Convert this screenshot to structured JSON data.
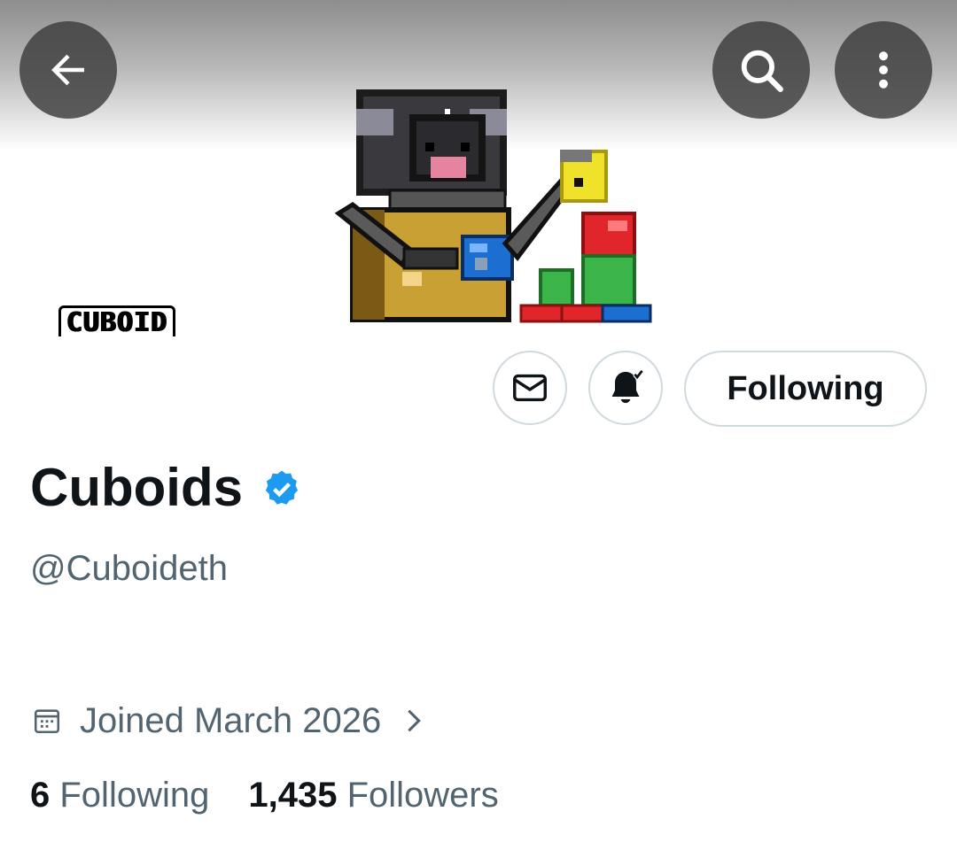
{
  "header": {
    "back_icon": "arrow-left-icon",
    "search_icon": "search-icon",
    "more_icon": "more-vertical-icon"
  },
  "banner": {
    "logo_text": "CUBOID"
  },
  "actions": {
    "message_icon": "mail-icon",
    "notifications_icon": "bell-check-icon",
    "follow_label": "Following"
  },
  "profile": {
    "display_name": "Cuboids",
    "handle": "@Cuboideth",
    "verified_icon": "verified-badge-icon",
    "joined": "Joined March 2026",
    "following_count": "6",
    "following_label": "Following",
    "followers_count": "1,435",
    "followers_label": "Followers"
  },
  "colors": {
    "text_primary": "#0f1419",
    "text_secondary": "#536471",
    "verified_blue": "#1d9bf0",
    "button_border": "#cfd9de"
  }
}
